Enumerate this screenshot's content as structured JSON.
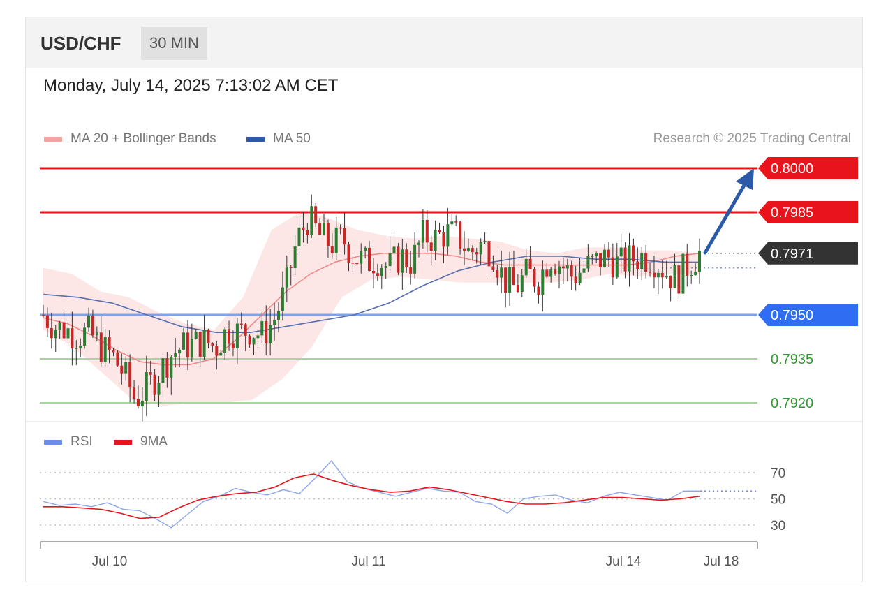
{
  "header": {
    "symbol": "USD/CHF",
    "interval": "30 MIN"
  },
  "timestamp": "Monday, July 14, 2025 7:13:02 AM CET",
  "legend_main": [
    {
      "label": "MA 20 + Bollinger Bands",
      "color": "#f08a8a"
    },
    {
      "label": "MA 50",
      "color": "#2b5aa8"
    }
  ],
  "credit": "Research © 2025 Trading Central",
  "legend_rsi": [
    {
      "label": "RSI",
      "color": "#5b86e5"
    },
    {
      "label": "9MA",
      "color": "#e8131b"
    }
  ],
  "colors": {
    "resistance": "#e8131b",
    "pivot": "#2f6df2",
    "support": "#2e9a2e",
    "current": "#333333",
    "arrow": "#2b5aa8",
    "bullish_candle": "#2e7d32",
    "bearish_candle": "#c62828"
  },
  "chart_data": [
    {
      "type": "candlestick",
      "price_axis": {
        "min": 0.7915,
        "max": 0.8005
      },
      "levels": [
        {
          "value": 0.8,
          "label": "0.8000",
          "kind": "resistance"
        },
        {
          "value": 0.7985,
          "label": "0.7985",
          "kind": "resistance"
        },
        {
          "value": 0.7971,
          "label": "0.7971",
          "kind": "current"
        },
        {
          "value": 0.795,
          "label": "0.7950",
          "kind": "pivot"
        },
        {
          "value": 0.7935,
          "label": "0.7935",
          "kind": "support"
        },
        {
          "value": 0.792,
          "label": "0.7920",
          "kind": "support"
        }
      ],
      "close_path": [
        0.795,
        0.7946,
        0.7945,
        0.7943,
        0.7944,
        0.7939,
        0.7936,
        0.793,
        0.7921,
        0.7925,
        0.793,
        0.7936,
        0.7939,
        0.794,
        0.7941,
        0.7939,
        0.7945,
        0.7944,
        0.7945,
        0.7943,
        0.7948,
        0.7958,
        0.7975,
        0.7983,
        0.7977,
        0.7974,
        0.7976,
        0.797,
        0.7968,
        0.7969,
        0.7966,
        0.797,
        0.7968,
        0.7977,
        0.7976,
        0.7978,
        0.7977,
        0.7971,
        0.7974,
        0.7972,
        0.7962,
        0.7959,
        0.7964,
        0.7962,
        0.797,
        0.7967,
        0.7963,
        0.7966,
        0.7968,
        0.797,
        0.7967,
        0.7969,
        0.797,
        0.7969,
        0.7965,
        0.7962,
        0.7967,
        0.7971
      ],
      "ma20_bollinger_mid": [
        0.7949,
        0.7947,
        0.7943,
        0.7938,
        0.7934,
        0.7933,
        0.7933,
        0.7935,
        0.7942,
        0.795,
        0.7958,
        0.7964,
        0.7968,
        0.797,
        0.7971,
        0.7971,
        0.7971,
        0.797,
        0.7968,
        0.7967,
        0.7967,
        0.7967,
        0.7967,
        0.7967,
        0.7967,
        0.7968,
        0.797,
        0.7971
      ],
      "bollinger_upper": [
        0.7966,
        0.7964,
        0.7958,
        0.7956,
        0.7951,
        0.7947,
        0.7945,
        0.7956,
        0.7979,
        0.7985,
        0.7983,
        0.7979,
        0.7977,
        0.7976,
        0.7977,
        0.7976,
        0.7975,
        0.7972,
        0.7971,
        0.7973,
        0.7973,
        0.7972,
        0.7972,
        0.7971
      ],
      "bollinger_lower": [
        0.7945,
        0.7939,
        0.793,
        0.7921,
        0.7919,
        0.792,
        0.792,
        0.7921,
        0.7928,
        0.7939,
        0.7956,
        0.7962,
        0.7963,
        0.7962,
        0.7961,
        0.7961,
        0.7961,
        0.7961,
        0.7962,
        0.7964,
        0.7963,
        0.7964,
        0.7964
      ],
      "ma50": [
        0.7957,
        0.7956,
        0.7954,
        0.795,
        0.7946,
        0.7944,
        0.7944,
        0.7946,
        0.7948,
        0.795,
        0.7954,
        0.796,
        0.7965,
        0.7968,
        0.797,
        0.797,
        0.7969,
        0.7969,
        0.7968,
        0.7968
      ],
      "projection_target": 0.8
    },
    {
      "type": "line",
      "y_ticks": [
        70,
        50,
        30
      ],
      "x_ticks": [
        "Jul 10",
        "Jul 11",
        "Jul 14",
        "Jul 18"
      ],
      "series": [
        {
          "name": "RSI",
          "values": [
            48,
            45,
            46,
            44,
            47,
            42,
            41,
            35,
            28,
            38,
            48,
            52,
            58,
            55,
            53,
            57,
            54,
            66,
            79,
            63,
            58,
            55,
            52,
            55,
            58,
            56,
            55,
            48,
            46,
            39,
            50,
            52,
            53,
            49,
            47,
            52,
            55,
            53,
            51,
            49,
            56,
            56
          ]
        },
        {
          "name": "9MA",
          "values": [
            44,
            44,
            43,
            42,
            39,
            35,
            36,
            43,
            49,
            52,
            54,
            55,
            59,
            66,
            69,
            64,
            60,
            57,
            55,
            56,
            59,
            57,
            54,
            51,
            48,
            46,
            46,
            47,
            49,
            51,
            51,
            50,
            49,
            50,
            52
          ]
        }
      ]
    }
  ]
}
